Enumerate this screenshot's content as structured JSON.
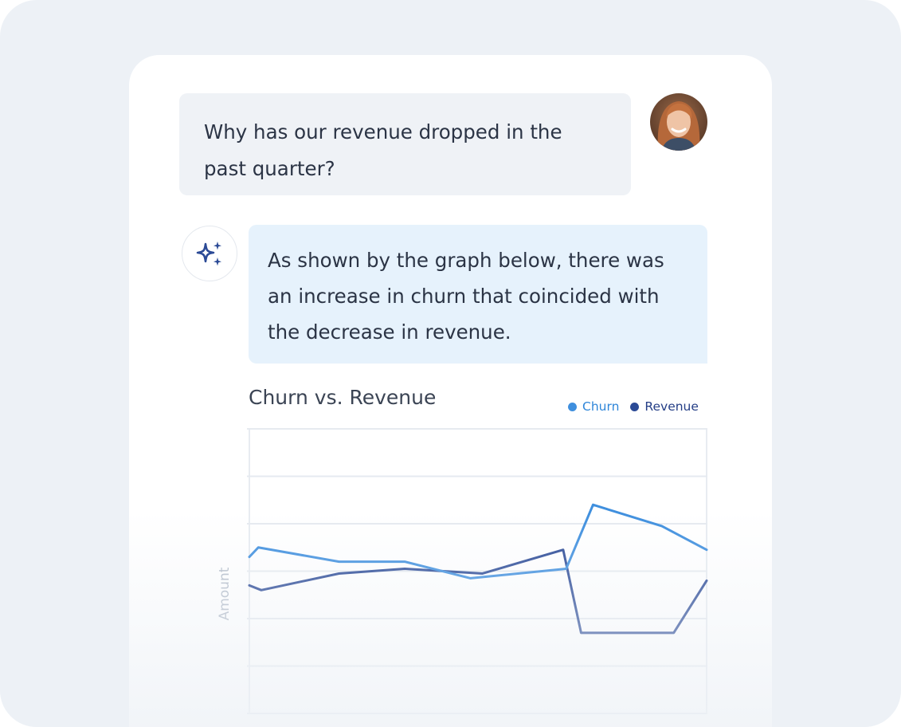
{
  "conversation": {
    "user_message": "Why has our revenue dropped in the past quarter?",
    "user_avatar": "woman-portrait-avatar",
    "assistant_icon": "sparkle-icon",
    "assistant_message": "As shown by the graph below, there was an increase in churn that coincided with the decrease in revenue."
  },
  "chart": {
    "title": "Churn vs. Revenue",
    "ylabel": "Amount"
  },
  "colors": {
    "churn": "#3f8fde",
    "revenue": "#2b4a96",
    "churn_legend_text": "#2f86d9",
    "revenue_legend_text": "#243e86"
  },
  "chart_data": {
    "type": "line",
    "title": "Churn vs. Revenue",
    "xlabel": "",
    "ylabel": "Amount",
    "ylim": [
      0,
      6
    ],
    "grid": true,
    "legend_placement": "top-right",
    "x": [
      0,
      0.15,
      1.0,
      2.3,
      3.4,
      4.3,
      5.25,
      5.45,
      6.75,
      7.2,
      7.65
    ],
    "series": [
      {
        "name": "Churn",
        "x": [
          0,
          0.15,
          1.5,
          2.6,
          3.7,
          5.3,
          5.75,
          6.9,
          7.65
        ],
        "values": [
          3.3,
          3.5,
          3.2,
          3.2,
          2.85,
          3.05,
          4.4,
          3.95,
          3.45
        ]
      },
      {
        "name": "Revenue",
        "x": [
          0,
          0.2,
          1.5,
          2.6,
          3.9,
          5.25,
          5.55,
          7.1,
          7.65
        ],
        "values": [
          2.7,
          2.6,
          2.95,
          3.05,
          2.95,
          3.45,
          1.7,
          1.7,
          2.8
        ]
      }
    ]
  }
}
